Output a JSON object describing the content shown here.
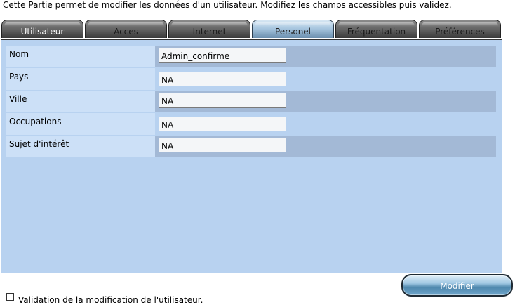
{
  "intro": "Cette Partie permet de modifier les données d'un utilisateur. Modifiez les champs accessibles puis validez.",
  "tabs": [
    {
      "label": "Utilisateur"
    },
    {
      "label": "Acces"
    },
    {
      "label": "Internet"
    },
    {
      "label": "Personel"
    },
    {
      "label": "Fréquentation"
    },
    {
      "label": "Préférences"
    }
  ],
  "active_tab": "Personel",
  "fields": [
    {
      "label": "Nom",
      "value": "Admin_confirme"
    },
    {
      "label": "Pays",
      "value": "NA"
    },
    {
      "label": "Ville",
      "value": "NA"
    },
    {
      "label": "Occupations",
      "value": "NA"
    },
    {
      "label": "Sujet d'intérêt",
      "value": "NA"
    }
  ],
  "modify_button": "Modifier",
  "validation": {
    "label": "Validation de la modification de l'utilisateur.",
    "checked": false
  },
  "colors": {
    "panel": "#b8d2f0",
    "label_cell": "#cce0f7",
    "value_cell_dark": "#a3b9d6",
    "tab_inactive": "#6c6c6c",
    "tab_active": "#a9c7e0"
  }
}
